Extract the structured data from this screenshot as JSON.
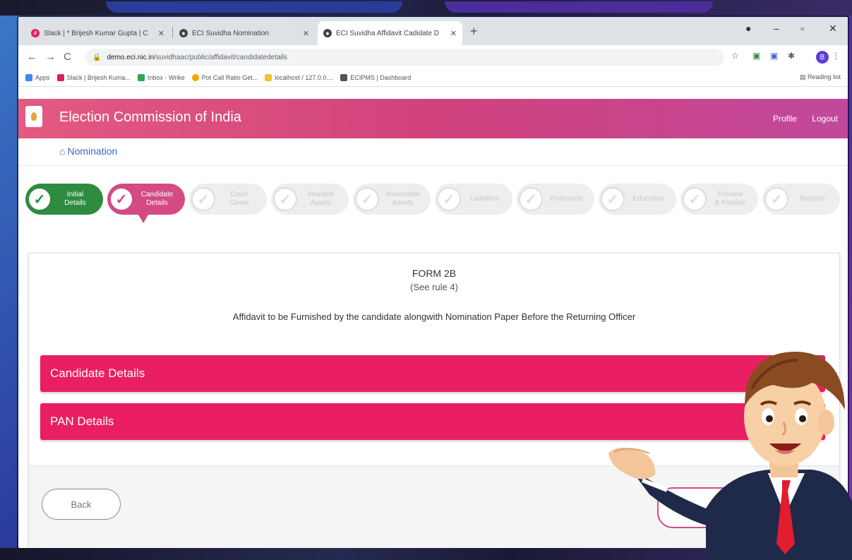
{
  "browser": {
    "tabs": [
      {
        "title": "Slack | * Brijesh Kumar Gupta | C",
        "active": false
      },
      {
        "title": "ECI Suvidha Nomination",
        "active": false
      },
      {
        "title": "ECI Suvidha Affidavit Cadidate D",
        "active": true
      }
    ],
    "new_tab": "+",
    "url_host": "demo.eci.nic.in",
    "url_path": "/suvidhaac/public/affidavit/candidatedetails",
    "profile_initial": "B",
    "bookmarks": [
      {
        "label": "Apps",
        "color": "#4285f4"
      },
      {
        "label": "Slack | Brijesh Kuma...",
        "color": "#e01e5a"
      },
      {
        "label": "Inbox - Wrike",
        "color": "#2fa84f"
      },
      {
        "label": "Pot Call Ratio Get...",
        "color": "#f4a300"
      },
      {
        "label": "localhost / 127.0.0....",
        "color": "#f2c12e"
      },
      {
        "label": "ECIPMS | Dashboard",
        "color": "#555555"
      }
    ],
    "reading_list": "Reading list"
  },
  "app": {
    "title": "Election Commission of India",
    "header_links": [
      "Profile",
      "Logout"
    ],
    "breadcrumb": "Nomination",
    "colors": {
      "header": "#d1427c",
      "accordion": "#e91e63",
      "done_step": "#2e8b3f",
      "current_step": "#d44a82"
    }
  },
  "steps": [
    {
      "label": "Initial\nDetails",
      "state": "done"
    },
    {
      "label": "Candidate\nDetails",
      "state": "current"
    },
    {
      "label": "Court\nCases",
      "state": "todo"
    },
    {
      "label": "Movable\nAssets",
      "state": "todo"
    },
    {
      "label": "Immovable\nAssets",
      "state": "todo"
    },
    {
      "label": "Liabilities",
      "state": "todo"
    },
    {
      "label": "Profession",
      "state": "todo"
    },
    {
      "label": "Education",
      "state": "todo"
    },
    {
      "label": "Preview\n& Finalize",
      "state": "todo"
    },
    {
      "label": "Reports",
      "state": "todo"
    }
  ],
  "form": {
    "title": "FORM 2B",
    "rule": "(See rule 4)",
    "description": "Affidavit to be Furnished by the candidate alongwith Nomination Paper Before the Returning Officer",
    "sections": [
      "Candidate Details",
      "PAN Details"
    ],
    "back_label": "Back"
  }
}
